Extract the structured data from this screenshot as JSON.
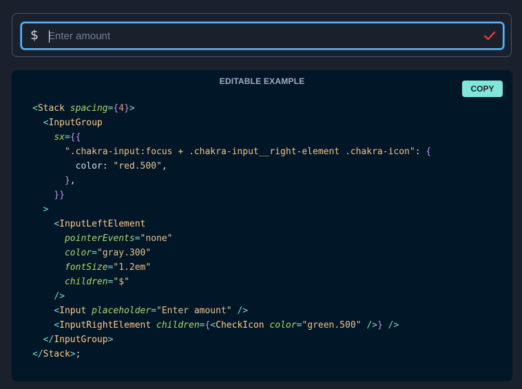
{
  "input": {
    "left_symbol": "$",
    "placeholder": "Enter amount",
    "value": ""
  },
  "example": {
    "label": "EDITABLE EXAMPLE",
    "copy_label": "COPY"
  },
  "code_lines": [
    [
      {
        "t": "<",
        "c": "punct"
      },
      {
        "t": "Stack",
        "c": "tag"
      },
      {
        "t": " ",
        "c": "plain"
      },
      {
        "t": "spacing",
        "c": "attr"
      },
      {
        "t": "=",
        "c": "punct"
      },
      {
        "t": "{",
        "c": "brace"
      },
      {
        "t": "4",
        "c": "num"
      },
      {
        "t": "}",
        "c": "brace"
      },
      {
        "t": ">",
        "c": "punct"
      }
    ],
    [
      {
        "t": "  ",
        "c": "plain"
      },
      {
        "t": "<",
        "c": "punct"
      },
      {
        "t": "InputGroup",
        "c": "tag"
      }
    ],
    [
      {
        "t": "    ",
        "c": "plain"
      },
      {
        "t": "sx",
        "c": "attr"
      },
      {
        "t": "=",
        "c": "punct"
      },
      {
        "t": "{{",
        "c": "brace"
      }
    ],
    [
      {
        "t": "      ",
        "c": "plain"
      },
      {
        "t": "\".chakra-input:focus + .chakra-input__right-element .chakra-icon\"",
        "c": "str"
      },
      {
        "t": ": ",
        "c": "plain"
      },
      {
        "t": "{",
        "c": "brace"
      }
    ],
    [
      {
        "t": "        ",
        "c": "plain"
      },
      {
        "t": "color",
        "c": "plain"
      },
      {
        "t": ": ",
        "c": "plain"
      },
      {
        "t": "\"red.500\"",
        "c": "str"
      },
      {
        "t": ",",
        "c": "plain"
      }
    ],
    [
      {
        "t": "      ",
        "c": "plain"
      },
      {
        "t": "}",
        "c": "brace"
      },
      {
        "t": ",",
        "c": "plain"
      }
    ],
    [
      {
        "t": "    ",
        "c": "plain"
      },
      {
        "t": "}}",
        "c": "brace"
      }
    ],
    [
      {
        "t": "  ",
        "c": "plain"
      },
      {
        "t": ">",
        "c": "punct"
      }
    ],
    [
      {
        "t": "    ",
        "c": "plain"
      },
      {
        "t": "<",
        "c": "punct"
      },
      {
        "t": "InputLeftElement",
        "c": "tag"
      }
    ],
    [
      {
        "t": "      ",
        "c": "plain"
      },
      {
        "t": "pointerEvents",
        "c": "attr"
      },
      {
        "t": "=",
        "c": "punct"
      },
      {
        "t": "\"none\"",
        "c": "str"
      }
    ],
    [
      {
        "t": "      ",
        "c": "plain"
      },
      {
        "t": "color",
        "c": "attr"
      },
      {
        "t": "=",
        "c": "punct"
      },
      {
        "t": "\"gray.300\"",
        "c": "str"
      }
    ],
    [
      {
        "t": "      ",
        "c": "plain"
      },
      {
        "t": "fontSize",
        "c": "attr"
      },
      {
        "t": "=",
        "c": "punct"
      },
      {
        "t": "\"1.2em\"",
        "c": "str"
      }
    ],
    [
      {
        "t": "      ",
        "c": "plain"
      },
      {
        "t": "children",
        "c": "attr"
      },
      {
        "t": "=",
        "c": "punct"
      },
      {
        "t": "\"$\"",
        "c": "str"
      }
    ],
    [
      {
        "t": "    ",
        "c": "plain"
      },
      {
        "t": "/>",
        "c": "punct"
      }
    ],
    [
      {
        "t": "    ",
        "c": "plain"
      },
      {
        "t": "<",
        "c": "punct"
      },
      {
        "t": "Input",
        "c": "tag"
      },
      {
        "t": " ",
        "c": "plain"
      },
      {
        "t": "placeholder",
        "c": "attr"
      },
      {
        "t": "=",
        "c": "punct"
      },
      {
        "t": "\"Enter amount\"",
        "c": "str"
      },
      {
        "t": " ",
        "c": "plain"
      },
      {
        "t": "/>",
        "c": "punct"
      }
    ],
    [
      {
        "t": "    ",
        "c": "plain"
      },
      {
        "t": "<",
        "c": "punct"
      },
      {
        "t": "InputRightElement",
        "c": "tag"
      },
      {
        "t": " ",
        "c": "plain"
      },
      {
        "t": "children",
        "c": "attr"
      },
      {
        "t": "=",
        "c": "punct"
      },
      {
        "t": "{",
        "c": "brace"
      },
      {
        "t": "<",
        "c": "punct"
      },
      {
        "t": "CheckIcon",
        "c": "tag"
      },
      {
        "t": " ",
        "c": "plain"
      },
      {
        "t": "color",
        "c": "attr"
      },
      {
        "t": "=",
        "c": "punct"
      },
      {
        "t": "\"green.500\"",
        "c": "str"
      },
      {
        "t": " ",
        "c": "plain"
      },
      {
        "t": "/>",
        "c": "punct"
      },
      {
        "t": "}",
        "c": "brace"
      },
      {
        "t": " ",
        "c": "plain"
      },
      {
        "t": "/>",
        "c": "punct"
      }
    ],
    [
      {
        "t": "  ",
        "c": "plain"
      },
      {
        "t": "</",
        "c": "punct"
      },
      {
        "t": "InputGroup",
        "c": "tag"
      },
      {
        "t": ">",
        "c": "punct"
      }
    ],
    [
      {
        "t": "</",
        "c": "punct"
      },
      {
        "t": "Stack",
        "c": "tag"
      },
      {
        "t": ">",
        "c": "punct"
      },
      {
        "t": ";",
        "c": "plain"
      }
    ]
  ],
  "icons": {
    "check": "check-icon"
  },
  "colors": {
    "focus_border": "#63b3ed",
    "check": "#e53e3e",
    "copy_button": "#81e6d9"
  }
}
